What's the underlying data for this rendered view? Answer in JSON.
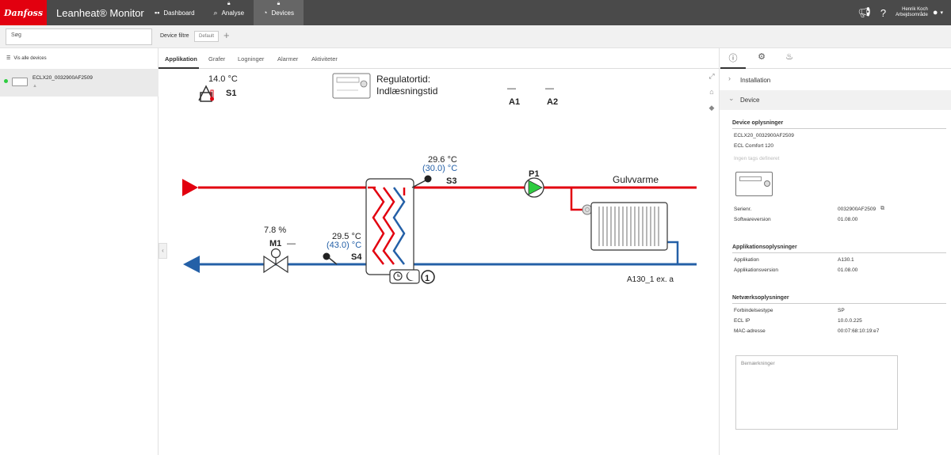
{
  "brand": {
    "logo_text": "Danfoss",
    "app_title": "Leanheat® Monitor",
    "accent": "#e2000f"
  },
  "nav": [
    {
      "label": "Dashboard",
      "icon": "dashboard-icon",
      "locked": false
    },
    {
      "label": "Analyse",
      "icon": "search-analytics-icon",
      "locked": true
    },
    {
      "label": "Devices",
      "icon": "devices-icon",
      "locked": true,
      "active": true
    }
  ],
  "user": {
    "name": "Henrik Koch",
    "area": "Arbejdsområde"
  },
  "filters": {
    "search_placeholder": "Søg",
    "device_filter_label": "Device filtre",
    "chip": "Default"
  },
  "left": {
    "show_all": "Vis alle devices",
    "device": {
      "name": "ECLX20_0032900AF2509",
      "status": "online"
    }
  },
  "tabs": [
    "Applikation",
    "Grafer",
    "Logninger",
    "Alarmer",
    "Aktiviteter"
  ],
  "diagram": {
    "s1_temp": "14.0 °C",
    "s1_label": "S1",
    "regulator_l1": "Regulatortid:",
    "regulator_l2": "Indlæsningstid",
    "a1_value": "—",
    "a1_label": "A1",
    "a2_value": "—",
    "a2_label": "A2",
    "s3_temp": "29.6 °C",
    "s3_set": "(30.0) °C",
    "s3_label": "S3",
    "p1_label": "P1",
    "circuit_name": "Gulvvarme",
    "m1_pct": "7.8 %",
    "m1_label": "M1",
    "m1_dash": "—",
    "s4_temp": "29.5 °C",
    "s4_set": "(43.0) °C",
    "s4_label": "S4",
    "circuit_number": "1",
    "app_code": "A130_1 ex. a",
    "colors": {
      "supply": "#e2000f",
      "return": "#2460a7",
      "setpoint_text": "#2460a7"
    }
  },
  "right": {
    "acc_installation": "Installation",
    "acc_device": "Device",
    "device_info": {
      "title": "Device oplysninger",
      "name": "ECLX20_0032900AF2509",
      "model": "ECL Comfort 120",
      "tags": "Ingen tags defineret"
    },
    "serial_label": "Serienr.",
    "serial_value": "0032900AF2509",
    "software_label": "Softwareversion",
    "software_value": "01.08.00",
    "app_info": {
      "title": "Applikationsoplysninger",
      "app_label": "Applikation",
      "app_value": "A130.1",
      "appver_label": "Applikationsversion",
      "appver_value": "01.08.00"
    },
    "net_info": {
      "title": "Netværksoplysninger",
      "conn_label": "Forbindelsestype",
      "conn_value": "SP",
      "ip_label": "ECL IP",
      "ip_value": "10.0.0.225",
      "mac_label": "MAC-adresse",
      "mac_value": "00:07:68:10:19:e7"
    },
    "remarks_placeholder": "Bemærkninger"
  }
}
